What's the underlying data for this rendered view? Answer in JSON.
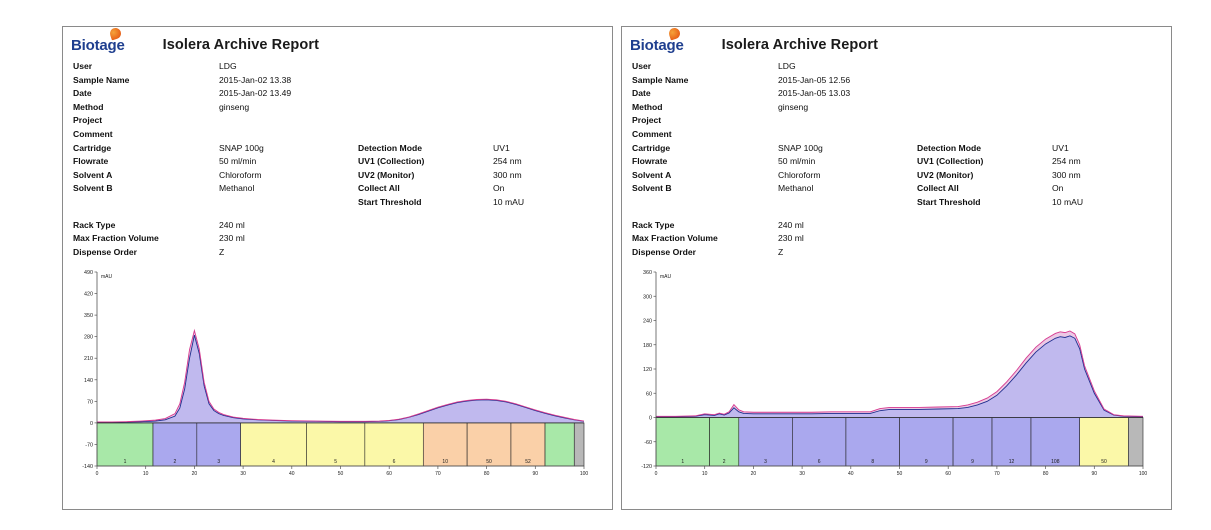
{
  "page": {
    "background": "#ffffff"
  },
  "brand": {
    "name": "Biotage",
    "color": "#1f3f8f",
    "leaf_color": "#e8641a",
    "leaf_icon": "leaf-icon"
  },
  "reports": [
    {
      "id": "left",
      "title": "Isolera Archive Report",
      "fields": [
        {
          "key": "User",
          "value": "LDG"
        },
        {
          "key": "Sample Name",
          "value": "2015-Jan-02 13.38"
        },
        {
          "key": "Date",
          "value": "2015-Jan-02 13.49"
        },
        {
          "key": "Method",
          "value": "ginseng"
        },
        {
          "key": "Project",
          "value": ""
        },
        {
          "key": "Comment",
          "value": ""
        }
      ],
      "fields2": [
        {
          "key": "Cartridge",
          "value": "SNAP 100g",
          "key2": "Detection Mode",
          "value2": "UV1"
        },
        {
          "key": "Flowrate",
          "value": "50 ml/min",
          "key2": "UV1 (Collection)",
          "value2": "254 nm"
        },
        {
          "key": "Solvent A",
          "value": "Chloroform",
          "key2": "UV2 (Monitor)",
          "value2": "300 nm"
        },
        {
          "key": "Solvent B",
          "value": "Methanol",
          "key2": "Collect All",
          "value2": "On"
        },
        {
          "key": "",
          "value": "",
          "key2": "Start Threshold",
          "value2": "10 mAU"
        }
      ],
      "fields3": [
        {
          "key": "Rack Type",
          "value": "240 ml"
        },
        {
          "key": "Max Fraction Volume",
          "value": "230 ml"
        },
        {
          "key": "Dispense Order",
          "value": "Z"
        }
      ],
      "chart_data": {
        "type": "area",
        "title": "",
        "xlabel": "",
        "ylabel": "mAU",
        "ylim": [
          -140,
          490
        ],
        "yticks": [
          490,
          420,
          350,
          280,
          210,
          140,
          70,
          0,
          -70,
          -140
        ],
        "xlim": [
          0,
          100
        ],
        "xticks": [
          0,
          10,
          20,
          30,
          40,
          50,
          60,
          70,
          80,
          90,
          100
        ],
        "xtick_labels": [
          "0",
          "10",
          "20",
          "30",
          "40",
          "50",
          "60",
          "70",
          "80",
          "90",
          "100"
        ],
        "grid": false,
        "legend": "none",
        "series": [
          {
            "name": "UV1 (Collection) 254 nm",
            "color": "#1f2f8f",
            "x": [
              0,
              3,
              6,
              9,
              12,
              14,
              16,
              17,
              18,
              19,
              20,
              21,
              22,
              23,
              24,
              25,
              26,
              28,
              30,
              33,
              36,
              40,
              45,
              50,
              55,
              58,
              60,
              62,
              64,
              66,
              68,
              70,
              72,
              74,
              76,
              78,
              80,
              82,
              84,
              86,
              88,
              90,
              92,
              94,
              96,
              98,
              100
            ],
            "y": [
              2,
              2,
              3,
              4,
              6,
              10,
              22,
              48,
              110,
              210,
              285,
              225,
              120,
              62,
              40,
              30,
              24,
              17,
              13,
              10,
              8,
              6,
              5,
              4,
              4,
              5,
              7,
              11,
              18,
              27,
              38,
              49,
              58,
              66,
              71,
              74,
              75,
              73,
              68,
              60,
              50,
              40,
              31,
              23,
              16,
              10,
              5
            ]
          },
          {
            "name": "UV2 (Monitor) 300 nm",
            "color": "#d63a8f",
            "x": [
              0,
              3,
              6,
              9,
              12,
              14,
              16,
              17,
              18,
              19,
              20,
              21,
              22,
              23,
              24,
              25,
              26,
              28,
              30,
              33,
              36,
              40,
              45,
              50,
              55,
              58,
              60,
              62,
              64,
              66,
              68,
              70,
              72,
              74,
              76,
              78,
              80,
              82,
              84,
              86,
              88,
              90,
              92,
              94,
              96,
              98,
              100
            ],
            "y": [
              3,
              3,
              4,
              6,
              9,
              14,
              30,
              62,
              132,
              238,
              300,
              240,
              132,
              70,
              45,
              34,
              27,
              19,
              15,
              11,
              9,
              7,
              6,
              5,
              5,
              6,
              8,
              12,
              19,
              29,
              40,
              51,
              60,
              68,
              73,
              76,
              77,
              75,
              70,
              62,
              52,
              42,
              33,
              25,
              18,
              11,
              6
            ]
          }
        ],
        "fractions": [
          {
            "label": "1",
            "start": 0,
            "end": 11.5,
            "color": "#a8e8a8"
          },
          {
            "label": "2",
            "start": 11.5,
            "end": 20.5,
            "color": "#aaa8ee"
          },
          {
            "label": "3",
            "start": 20.5,
            "end": 29.5,
            "color": "#aaa8ee"
          },
          {
            "label": "4",
            "start": 29.5,
            "end": 43,
            "color": "#fbf8a8"
          },
          {
            "label": "5",
            "start": 43,
            "end": 55,
            "color": "#fbf8a8"
          },
          {
            "label": "6",
            "start": 55,
            "end": 67,
            "color": "#fbf8a8"
          },
          {
            "label": "10",
            "start": 67,
            "end": 76,
            "color": "#fad0a8"
          },
          {
            "label": "50",
            "start": 76,
            "end": 85,
            "color": "#fad0a8"
          },
          {
            "label": "52",
            "start": 85,
            "end": 92,
            "color": "#fad0a8"
          },
          {
            "label": "",
            "start": 92,
            "end": 98,
            "color": "#a8e8a8"
          },
          {
            "label": "",
            "start": 98,
            "end": 100,
            "color": "#b8b8b8"
          }
        ]
      }
    },
    {
      "id": "right",
      "title": "Isolera Archive Report",
      "fields": [
        {
          "key": "User",
          "value": "LDG"
        },
        {
          "key": "Sample Name",
          "value": "2015-Jan-05 12.56"
        },
        {
          "key": "Date",
          "value": "2015-Jan-05 13.03"
        },
        {
          "key": "Method",
          "value": "ginseng"
        },
        {
          "key": "Project",
          "value": ""
        },
        {
          "key": "Comment",
          "value": ""
        }
      ],
      "fields2": [
        {
          "key": "Cartridge",
          "value": "SNAP 100g",
          "key2": "Detection Mode",
          "value2": "UV1"
        },
        {
          "key": "Flowrate",
          "value": "50 ml/min",
          "key2": "UV1 (Collection)",
          "value2": "254 nm"
        },
        {
          "key": "Solvent A",
          "value": "Chloroform",
          "key2": "UV2 (Monitor)",
          "value2": "300 nm"
        },
        {
          "key": "Solvent B",
          "value": "Methanol",
          "key2": "Collect All",
          "value2": "On"
        },
        {
          "key": "",
          "value": "",
          "key2": "Start Threshold",
          "value2": "10 mAU"
        }
      ],
      "fields3": [
        {
          "key": "Rack Type",
          "value": "240 ml"
        },
        {
          "key": "Max Fraction Volume",
          "value": "230 ml"
        },
        {
          "key": "Dispense Order",
          "value": "Z"
        }
      ],
      "chart_data": {
        "type": "area",
        "title": "",
        "xlabel": "",
        "ylabel": "mAU",
        "ylim": [
          -120,
          360
        ],
        "yticks": [
          360,
          300,
          240,
          180,
          120,
          60,
          0,
          -60,
          -120
        ],
        "xlim": [
          0,
          100
        ],
        "xticks": [
          0,
          10,
          20,
          30,
          40,
          50,
          60,
          70,
          80,
          90,
          100
        ],
        "xtick_labels": [
          "0",
          "10",
          "20",
          "30",
          "40",
          "50",
          "60",
          "70",
          "80",
          "90",
          "100"
        ],
        "grid": false,
        "legend": "none",
        "series": [
          {
            "name": "UV1 (Collection) 254 nm",
            "color": "#1f2f8f",
            "x": [
              0,
              4,
              8,
              10,
              12,
              13,
              14,
              15,
              16,
              17,
              18,
              20,
              24,
              28,
              32,
              36,
              40,
              44,
              46,
              48,
              50,
              54,
              58,
              62,
              64,
              66,
              68,
              70,
              72,
              74,
              76,
              78,
              80,
              82,
              83,
              84,
              85,
              86,
              87,
              88,
              90,
              92,
              94,
              96,
              100
            ],
            "y": [
              2,
              2,
              3,
              7,
              5,
              9,
              6,
              11,
              24,
              14,
              10,
              9,
              9,
              9,
              9,
              10,
              10,
              10,
              17,
              20,
              20,
              20,
              21,
              22,
              25,
              31,
              40,
              55,
              78,
              105,
              135,
              162,
              182,
              196,
              200,
              198,
              202,
              196,
              170,
              120,
              60,
              18,
              6,
              3,
              2
            ]
          },
          {
            "name": "UV2 (Monitor) 300 nm",
            "color": "#d63a8f",
            "x": [
              0,
              4,
              8,
              10,
              12,
              13,
              14,
              15,
              16,
              17,
              18,
              20,
              24,
              28,
              32,
              36,
              40,
              44,
              46,
              48,
              50,
              54,
              58,
              62,
              64,
              66,
              68,
              70,
              72,
              74,
              76,
              78,
              80,
              82,
              83,
              84,
              85,
              86,
              87,
              88,
              90,
              92,
              94,
              96,
              100
            ],
            "y": [
              3,
              3,
              4,
              9,
              7,
              11,
              8,
              14,
              32,
              19,
              14,
              13,
              13,
              13,
              13,
              14,
              14,
              14,
              22,
              25,
              25,
              25,
              26,
              27,
              31,
              38,
              48,
              64,
              88,
              116,
              147,
              174,
              194,
              208,
              212,
              210,
              214,
              207,
              180,
              128,
              66,
              21,
              7,
              4,
              3
            ]
          }
        ],
        "fractions": [
          {
            "label": "1",
            "start": 0,
            "end": 11,
            "color": "#a8e8a8"
          },
          {
            "label": "2",
            "start": 11,
            "end": 17,
            "color": "#a8e8a8"
          },
          {
            "label": "3",
            "start": 17,
            "end": 28,
            "color": "#aaa8ee"
          },
          {
            "label": "6",
            "start": 28,
            "end": 39,
            "color": "#aaa8ee"
          },
          {
            "label": "8",
            "start": 39,
            "end": 50,
            "color": "#aaa8ee"
          },
          {
            "label": "9",
            "start": 50,
            "end": 61,
            "color": "#aaa8ee"
          },
          {
            "label": "9",
            "start": 61,
            "end": 69,
            "color": "#aaa8ee"
          },
          {
            "label": "12",
            "start": 69,
            "end": 77,
            "color": "#aaa8ee"
          },
          {
            "label": "108",
            "start": 77,
            "end": 87,
            "color": "#aaa8ee"
          },
          {
            "label": "50",
            "start": 87,
            "end": 97,
            "color": "#fbf8a8"
          },
          {
            "label": "",
            "start": 97,
            "end": 100,
            "color": "#b8b8b8"
          }
        ]
      }
    }
  ]
}
